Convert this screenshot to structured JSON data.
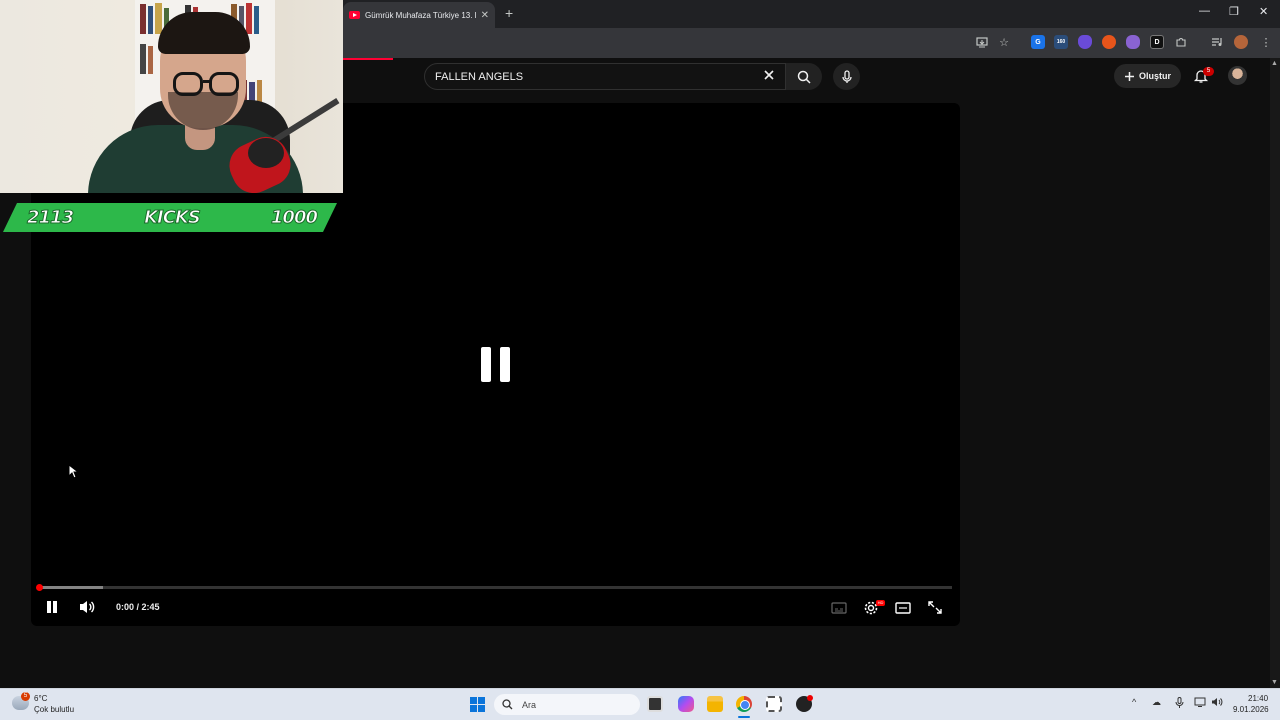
{
  "browser": {
    "tab_title": "Gümrük Muhafaza Türkiye 13. B",
    "tab_close": "✕",
    "new_tab": "+",
    "window_controls": {
      "minimize": "—",
      "restore": "❐",
      "close": "✕"
    }
  },
  "youtube": {
    "search_query": "FALLEN ANGELS",
    "create_label": "Oluştur",
    "notification_count": "5"
  },
  "player": {
    "time_display": "0:00 / 2:45",
    "state": "paused",
    "progress_fraction": 0,
    "buffered_fraction": 0.07,
    "settings_badge": "HD"
  },
  "stream_overlay": {
    "left_count": "2113",
    "center_label": "KICKS",
    "right_count": "1000"
  },
  "taskbar": {
    "weather_badge": "5",
    "temperature": "6°C",
    "condition": "Çok bulutlu",
    "search_placeholder": "Ara",
    "time": "21:40",
    "date": "9.01.2026"
  },
  "colors": {
    "accent_red": "#ff0033",
    "counter_green": "#2db84a",
    "page_bg": "#0f0f0f"
  }
}
